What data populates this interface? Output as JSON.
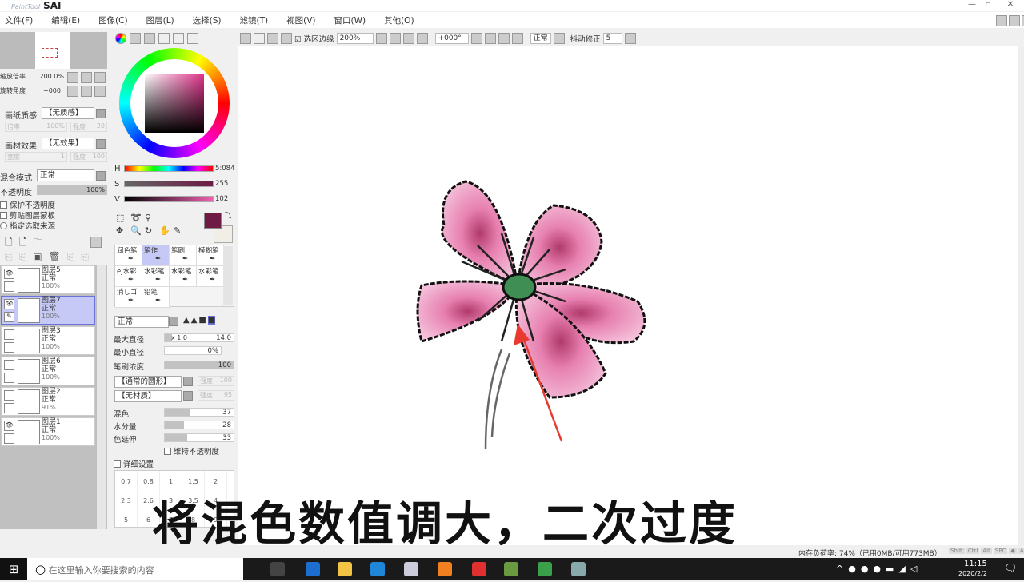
{
  "app": {
    "logo_small": "PaintTool",
    "logo_big": "SAI"
  },
  "menu": [
    "文件(F)",
    "编辑(E)",
    "图像(C)",
    "图层(L)",
    "选择(S)",
    "滤镜(T)",
    "视图(V)",
    "窗口(W)",
    "其他(O)"
  ],
  "toolbar": {
    "selection_edge_label": "选区边缘",
    "zoom": "200%",
    "rotation": "+000°",
    "mode": "正常",
    "stabilizer_label": "抖动修正",
    "stabilizer": "5"
  },
  "navigator": {
    "zoom_label": "缩放倍率",
    "zoom_value": "200.0%",
    "rotate_label": "旋转角度",
    "rotate_value": "+000"
  },
  "paper": {
    "texture_label": "画纸质感",
    "texture_value": "【无质感】",
    "scale_label": "倍率",
    "scale_value": "100%",
    "strength_label": "强度",
    "strength_value": "20",
    "effect_label": "画材效果",
    "effect_value": "【无效果】",
    "width_label": "宽度",
    "width_value": "1",
    "effect_strength_label": "强度",
    "effect_strength_value": "100"
  },
  "layer_props": {
    "blend_label": "混合模式",
    "blend_value": "正常",
    "opacity_label": "不透明度",
    "opacity_value": "100%",
    "protect_label": "保护不透明度",
    "clip_label": "剪贴图层蒙板",
    "source_label": "指定选取来源"
  },
  "layers": [
    {
      "name": "图层5",
      "mode": "正常",
      "opacity": "100%",
      "visible": true,
      "active": false
    },
    {
      "name": "图层7",
      "mode": "正常",
      "opacity": "100%",
      "visible": true,
      "active": true
    },
    {
      "name": "图层3",
      "mode": "正常",
      "opacity": "100%",
      "visible": false,
      "active": false
    },
    {
      "name": "图层6",
      "mode": "正常",
      "opacity": "100%",
      "visible": false,
      "active": false
    },
    {
      "name": "图层2",
      "mode": "正常",
      "opacity": "91%",
      "visible": false,
      "active": false
    },
    {
      "name": "图层1",
      "mode": "正常",
      "opacity": "100%",
      "visible": true,
      "active": false
    }
  ],
  "color": {
    "h_label": "H",
    "h_value": "5:084",
    "s_label": "S",
    "s_value": "255",
    "v_label": "V",
    "v_value": "102",
    "fg": "#6e1a45",
    "bg": "#f0eee6"
  },
  "brushes": [
    "润色笔",
    "笔作",
    "笔刷",
    "模糊笔",
    "ej水彩",
    "水彩笔",
    "水彩笔",
    "水彩笔",
    "消しゴ",
    "铅笔"
  ],
  "brush_settings": {
    "mode": "正常",
    "max_size_label": "最大直径",
    "max_size_mult": "x 1.0",
    "max_size": "14.0",
    "min_size_label": "最小直径",
    "min_size": "0%",
    "density_label": "笔刷浓度",
    "density": "100",
    "shape": "【通常的圆形】",
    "shape_strength_label": "强度",
    "shape_strength": "100",
    "texture": "【无材质】",
    "texture_strength_label": "强度",
    "texture_strength": "95",
    "blend_label": "混色",
    "blend": "37",
    "water_label": "水分量",
    "water": "28",
    "persist_label": "色延伸",
    "persist": "33",
    "keep_opacity_label": "维持不透明度",
    "detail_label": "详细设置"
  },
  "brush_sizes": [
    "0.7",
    "0.8",
    "1",
    "1.5",
    "2",
    "2.3",
    "2.6",
    "3",
    "3.5",
    "4",
    "5",
    "6",
    "7",
    "8",
    "9"
  ],
  "status": {
    "memory": "内存负荷率: 74%（已用0MB/可用773MB）",
    "keys": [
      "Shift",
      "Ctrl",
      "Alt",
      "SPC",
      "◆",
      "Any"
    ]
  },
  "taskbar": {
    "search_placeholder": "在这里输入你要搜索的内容",
    "time": "11:15",
    "date": "2020/2/2"
  },
  "caption": "将混色数值调大，二次过度"
}
